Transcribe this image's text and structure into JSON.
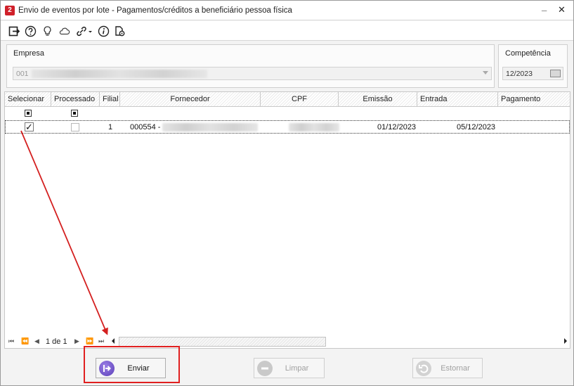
{
  "window": {
    "title": "Envio de eventos por lote - Pagamentos/créditos a beneficiário pessoa física",
    "minimize_label": "_",
    "close_label": "✕",
    "app_icon_letter": "2"
  },
  "toolbar": {
    "icons": [
      "exit-icon",
      "help-icon",
      "lightbulb-icon",
      "cloud-icon",
      "link-icon",
      "info-icon",
      "settings-page-icon"
    ]
  },
  "filters": {
    "empresa_label": "Empresa",
    "empresa_code": "001",
    "competencia_label": "Competência",
    "competencia_value": "12/2023"
  },
  "grid": {
    "columns": [
      "Selecionar",
      "Processado",
      "Filial",
      "Fornecedor",
      "CPF",
      "Emissão",
      "Entrada",
      "Pagamento"
    ],
    "rows": [
      {
        "selecionar": "✓",
        "filial": "1",
        "fornecedor_code": "000554 -",
        "emissao": "01/12/2023",
        "entrada": "05/12/2023"
      }
    ]
  },
  "navigator": {
    "page_text": "1 de 1",
    "first": "⏮",
    "prev_page": "⏪",
    "prev": "◀",
    "next": "▶",
    "next_page": "⏩",
    "last": "⏭"
  },
  "buttons": {
    "enviar": "Enviar",
    "limpar": "Limpar",
    "estornar": "Estornar"
  },
  "colors": {
    "annotation": "#e02020",
    "enviar_icon": "#6a4cc8"
  }
}
